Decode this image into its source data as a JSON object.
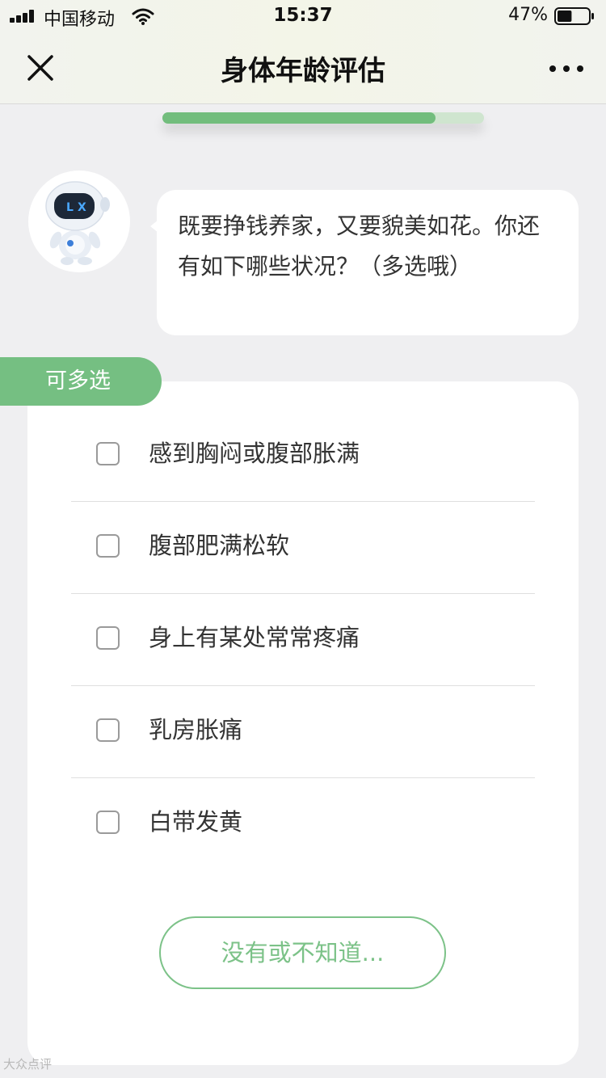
{
  "status_bar": {
    "carrier": "中国移动",
    "time": "15:37",
    "battery_percent": "47%",
    "battery_level": 0.47,
    "signal_icon": "signal-bars-icon",
    "wifi_icon": "wifi-icon",
    "battery_icon": "battery-icon"
  },
  "nav": {
    "title": "身体年龄评估",
    "close_icon": "close-icon",
    "more_icon": "more-dots-icon"
  },
  "progress": {
    "fraction": 0.85
  },
  "assistant": {
    "avatar_icon": "robot-avatar-icon",
    "message": "既要挣钱养家，又要貌美如花。你还有如下哪些状况？（多选哦）"
  },
  "question": {
    "tag": "可多选",
    "options": [
      {
        "label": "感到胸闷或腹部胀满",
        "checked": false
      },
      {
        "label": "腹部肥满松软",
        "checked": false
      },
      {
        "label": "身上有某处常常疼痛",
        "checked": false
      },
      {
        "label": "乳房胀痛",
        "checked": false
      },
      {
        "label": "白带发黄",
        "checked": false
      }
    ],
    "none_button": "没有或不知道..."
  },
  "watermark": {
    "text": "大众点评"
  },
  "colors": {
    "accent_green": "#75bf82",
    "progress_track": "#cfe5cf",
    "background": "#efeff1"
  }
}
